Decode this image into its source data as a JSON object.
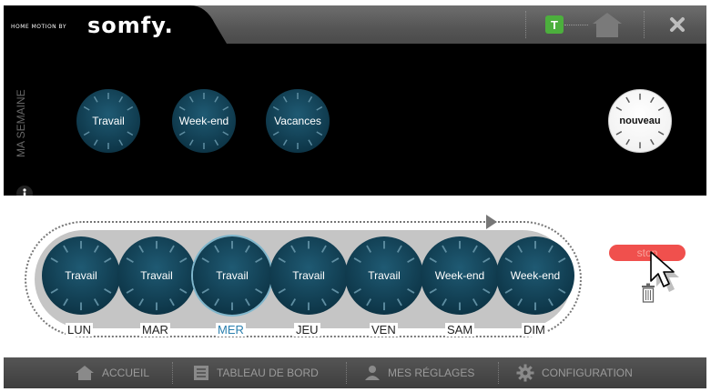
{
  "header": {
    "logo_small": "HOME MOTION BY",
    "logo_brand": "somfy.",
    "t_badge": "T"
  },
  "week_panel": {
    "side_label": "MA SEMAINE",
    "presets": [
      "Travail",
      "Week-end",
      "Vacances"
    ],
    "new_label": "nouveau"
  },
  "timeline": {
    "days": [
      {
        "day": "LUN",
        "preset": "Travail"
      },
      {
        "day": "MAR",
        "preset": "Travail"
      },
      {
        "day": "MER",
        "preset": "Travail",
        "selected": true
      },
      {
        "day": "JEU",
        "preset": "Travail"
      },
      {
        "day": "VEN",
        "preset": "Travail"
      },
      {
        "day": "SAM",
        "preset": "Week-end"
      },
      {
        "day": "DIM",
        "preset": "Week-end"
      }
    ],
    "stop_label": "stop"
  },
  "footer": {
    "accueil": "ACCUEIL",
    "tableau": "TABLEAU DE BORD",
    "reglages": "MES RÉGLAGES",
    "configuration": "CONFIGURATION"
  },
  "colors": {
    "dial": "#0d3547",
    "accent_blue": "#2a7fae",
    "stop_red": "#f0504d",
    "t_green": "#4caf3d"
  },
  "icons": [
    "home-icon",
    "close-icon",
    "info-icon",
    "trash-icon",
    "cursor-icon",
    "dashboard-icon",
    "user-icon",
    "gear-icon"
  ]
}
